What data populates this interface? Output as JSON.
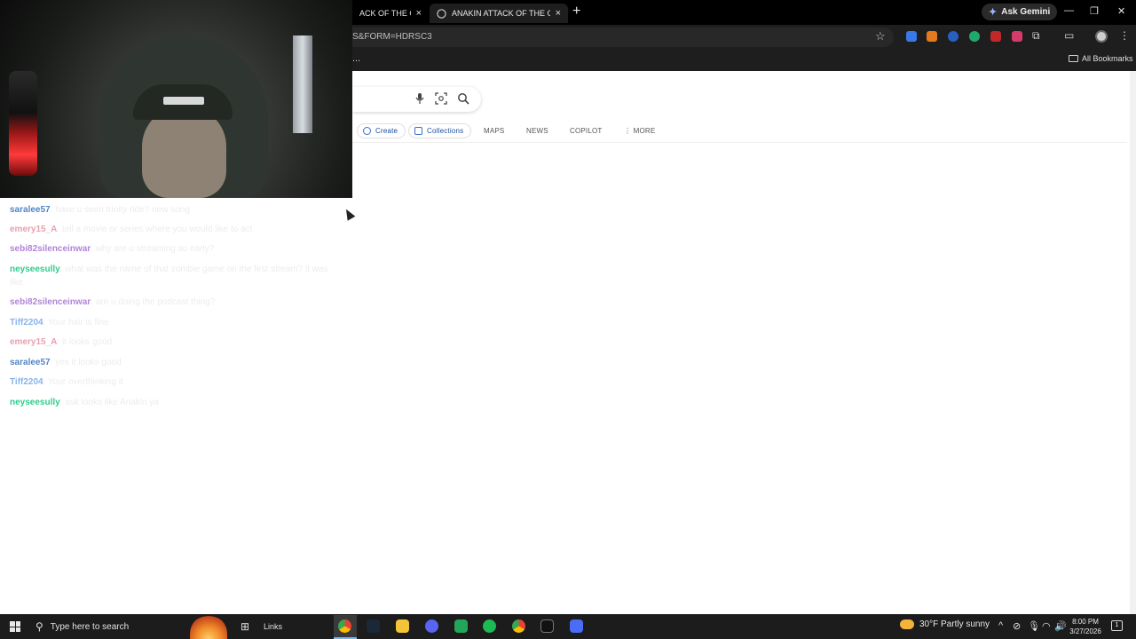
{
  "browser": {
    "tabs": [
      {
        "title": "ACK OF THE CLON",
        "close": "×"
      },
      {
        "title": "ANAKIN ATTACK OF THE CLON",
        "close": "×"
      }
    ],
    "new_tab": "+",
    "ask_gemini": "Ask Gemini",
    "window_controls": {
      "minimize": "—",
      "restore": "❐",
      "close": "✕"
    },
    "url": "S&FORM=HDRSC3",
    "star_icon": "star-icon",
    "bookmarks_overflow": "...",
    "all_bookmarks": "All Bookmarks"
  },
  "search_page": {
    "nav": {
      "create": "Create",
      "collections": "Collections",
      "maps": "MAPS",
      "news": "NEWS",
      "copilot": "COPILOT",
      "more": "⋮ MORE"
    }
  },
  "chat": {
    "messages": [
      {
        "user": "saralee57",
        "color": "#4f86c6",
        "text": "have u seen trinity ride? new song"
      },
      {
        "user": "emery15_A",
        "color": "#e6a1b0",
        "text": "tell a movie or series where you would like to act"
      },
      {
        "user": "sebi82silenceinwar",
        "color": "#b084d9",
        "text": "why are u streaming so early?"
      },
      {
        "user": "neyseesully",
        "color": "#2ecc8f",
        "text": "what was the name of that zombie game on the first stream? it was like"
      },
      {
        "user": "sebi82silenceinwar",
        "color": "#b084d9",
        "text": "are u doing the podcast thing?"
      },
      {
        "user": "Tiff2204",
        "color": "#8ab4e8",
        "text": "Your hair is fine"
      },
      {
        "user": "emery15_A",
        "color": "#e6a1b0",
        "text": "it looks good"
      },
      {
        "user": "saralee57",
        "color": "#4f86c6",
        "text": "yes it looks good"
      },
      {
        "user": "Tiff2204",
        "color": "#8ab4e8",
        "text": "Your overthinking it"
      },
      {
        "user": "neyseesully",
        "color": "#2ecc8f",
        "text": "ask looks like Anakin ya"
      }
    ]
  },
  "taskbar": {
    "search_placeholder": "Type here to search",
    "links_label": "Links",
    "weather": "30°F  Partly sunny",
    "time": "8:00 PM",
    "date": "3/27/2026",
    "notification_count": "1",
    "tray_up": "^"
  }
}
